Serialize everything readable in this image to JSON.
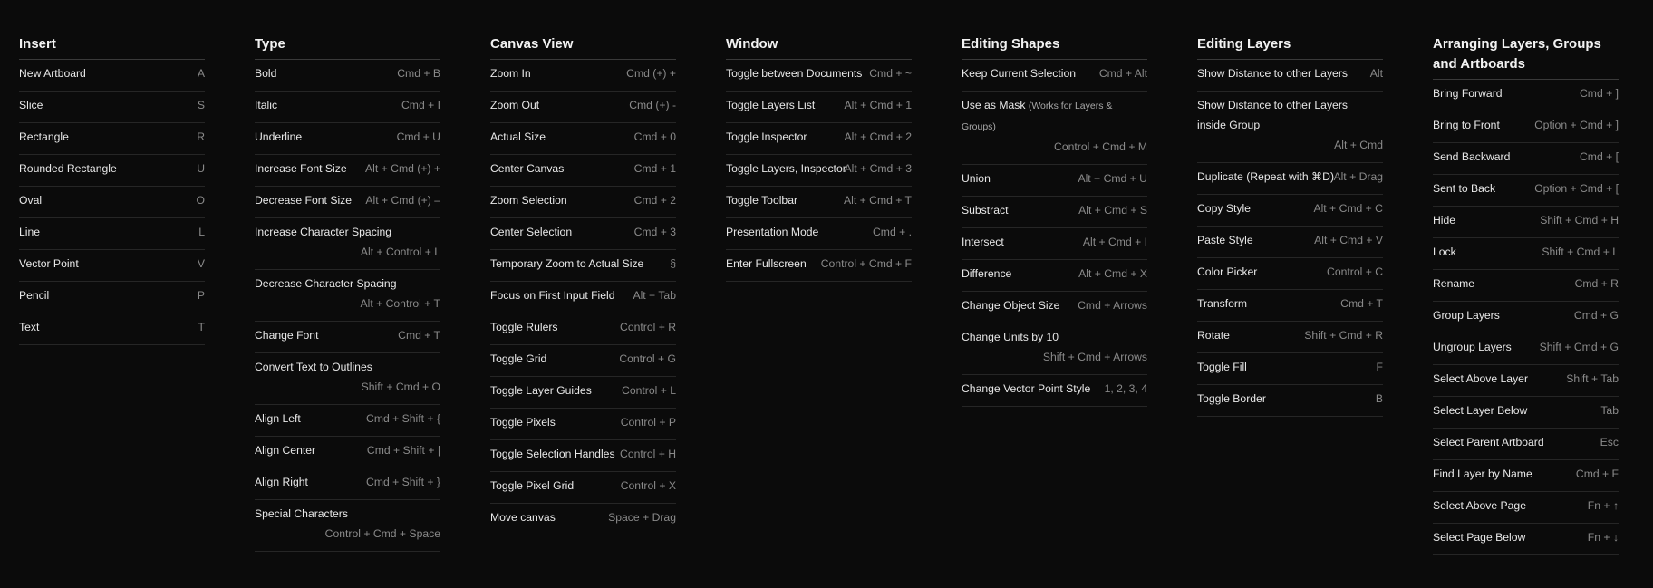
{
  "columns": [
    {
      "title": "Insert",
      "items": [
        {
          "label": "New Artboard",
          "key": "A"
        },
        {
          "label": "Slice",
          "key": "S"
        },
        {
          "label": "Rectangle",
          "key": "R"
        },
        {
          "label": "Rounded Rectangle",
          "key": "U"
        },
        {
          "label": "Oval",
          "key": "O"
        },
        {
          "label": "Line",
          "key": "L"
        },
        {
          "label": "Vector Point",
          "key": "V"
        },
        {
          "label": "Pencil",
          "key": "P"
        },
        {
          "label": "Text",
          "key": "T"
        }
      ]
    },
    {
      "title": "Type",
      "items": [
        {
          "label": "Bold",
          "key": "Cmd + B"
        },
        {
          "label": "Italic",
          "key": "Cmd + I"
        },
        {
          "label": "Underline",
          "key": "Cmd + U"
        },
        {
          "label": "Increase Font Size",
          "key": "Alt + Cmd (+) +"
        },
        {
          "label": "Decrease Font Size",
          "key": "Alt + Cmd (+) –"
        },
        {
          "label": "Increase Character Spacing",
          "key": "Alt + Control + L"
        },
        {
          "label": "Decrease Character Spacing",
          "key": "Alt + Control + T"
        },
        {
          "label": "Change Font",
          "key": "Cmd + T"
        },
        {
          "label": "Convert Text to Outlines",
          "key": "Shift + Cmd + O"
        },
        {
          "label": "Align Left",
          "key": "Cmd + Shift + {"
        },
        {
          "label": "Align Center",
          "key": "Cmd + Shift + |"
        },
        {
          "label": "Align Right",
          "key": "Cmd + Shift + }"
        },
        {
          "label": "Special Characters",
          "key": "Control + Cmd + Space"
        }
      ]
    },
    {
      "title": "Canvas View",
      "items": [
        {
          "label": "Zoom In",
          "key": "Cmd (+) +"
        },
        {
          "label": "Zoom Out",
          "key": "Cmd (+) -"
        },
        {
          "label": "Actual Size",
          "key": "Cmd + 0"
        },
        {
          "label": "Center Canvas",
          "key": "Cmd + 1"
        },
        {
          "label": "Zoom Selection",
          "key": "Cmd + 2"
        },
        {
          "label": "Center Selection",
          "key": "Cmd + 3"
        },
        {
          "label": "Temporary Zoom to Actual Size",
          "key": "§"
        },
        {
          "label": "Focus on First Input Field",
          "key": "Alt + Tab"
        },
        {
          "label": "Toggle Rulers",
          "key": "Control + R"
        },
        {
          "label": "Toggle Grid",
          "key": "Control + G"
        },
        {
          "label": "Toggle Layer Guides",
          "key": "Control + L"
        },
        {
          "label": "Toggle Pixels",
          "key": "Control + P"
        },
        {
          "label": "Toggle Selection Handles",
          "key": "Control + H"
        },
        {
          "label": "Toggle Pixel Grid",
          "key": "Control + X"
        },
        {
          "label": "Move canvas",
          "key": "Space + Drag"
        }
      ]
    },
    {
      "title": "Window",
      "items": [
        {
          "label": "Toggle between Documents",
          "key": "Cmd + ~"
        },
        {
          "label": "Toggle Layers List",
          "key": "Alt + Cmd + 1"
        },
        {
          "label": "Toggle Inspector",
          "key": "Alt + Cmd + 2"
        },
        {
          "label": "Toggle Layers, Inspector",
          "key": "Alt + Cmd + 3"
        },
        {
          "label": "Toggle Toolbar",
          "key": "Alt + Cmd + T"
        },
        {
          "label": "Presentation Mode",
          "key": "Cmd + ."
        },
        {
          "label": "Enter Fullscreen",
          "key": "Control + Cmd + F"
        }
      ]
    },
    {
      "title": "Editing Shapes",
      "items": [
        {
          "label": "Keep Current Selection",
          "key": "Cmd + Alt"
        },
        {
          "label": "Use as Mask",
          "note": "(Works for Layers & Groups)",
          "key": "Control + Cmd + M"
        },
        {
          "label": "Union",
          "key": "Alt + Cmd + U"
        },
        {
          "label": "Substract",
          "key": "Alt + Cmd + S"
        },
        {
          "label": "Intersect",
          "key": "Alt + Cmd + I"
        },
        {
          "label": "Difference",
          "key": "Alt + Cmd + X"
        },
        {
          "label": "Change Object Size",
          "key": "Cmd + Arrows"
        },
        {
          "label": "Change Units by 10",
          "key": "Shift + Cmd + Arrows"
        },
        {
          "label": "Change Vector Point Style",
          "key": "1, 2, 3, 4"
        }
      ]
    },
    {
      "title": "Editing Layers",
      "items": [
        {
          "label": "Show Distance to other Layers",
          "key": "Alt"
        },
        {
          "label": "Show Distance to other Layers inside Group",
          "key": "Alt + Cmd"
        },
        {
          "label": "Duplicate (Repeat with ⌘D)",
          "key": "Alt + Drag"
        },
        {
          "label": "Copy Style",
          "key": "Alt + Cmd + C"
        },
        {
          "label": "Paste Style",
          "key": "Alt + Cmd + V"
        },
        {
          "label": "Color Picker",
          "key": "Control + C"
        },
        {
          "label": "Transform",
          "key": "Cmd + T"
        },
        {
          "label": "Rotate",
          "key": "Shift + Cmd + R"
        },
        {
          "label": "Toggle Fill",
          "key": "F"
        },
        {
          "label": "Toggle Border",
          "key": "B"
        }
      ]
    },
    {
      "title": "Arranging Layers, Groups and Artboards",
      "items": [
        {
          "label": "Bring Forward",
          "key": "Cmd + ]"
        },
        {
          "label": "Bring to Front",
          "key": "Option + Cmd + ]"
        },
        {
          "label": "Send Backward",
          "key": "Cmd + ["
        },
        {
          "label": "Sent to Back",
          "key": "Option + Cmd + ["
        },
        {
          "label": "Hide",
          "key": "Shift + Cmd + H"
        },
        {
          "label": "Lock",
          "key": "Shift + Cmd + L"
        },
        {
          "label": "Rename",
          "key": "Cmd + R"
        },
        {
          "label": "Group Layers",
          "key": "Cmd + G"
        },
        {
          "label": "Ungroup Layers",
          "key": "Shift + Cmd + G"
        },
        {
          "label": "Select Above Layer",
          "key": "Shift + Tab"
        },
        {
          "label": "Select Layer Below",
          "key": "Tab"
        },
        {
          "label": "Select Parent Artboard",
          "key": "Esc"
        },
        {
          "label": "Find Layer by Name",
          "key": "Cmd + F"
        },
        {
          "label": "Select Above Page",
          "key": "Fn + ↑"
        },
        {
          "label": "Select Page Below",
          "key": "Fn + ↓"
        }
      ]
    }
  ]
}
